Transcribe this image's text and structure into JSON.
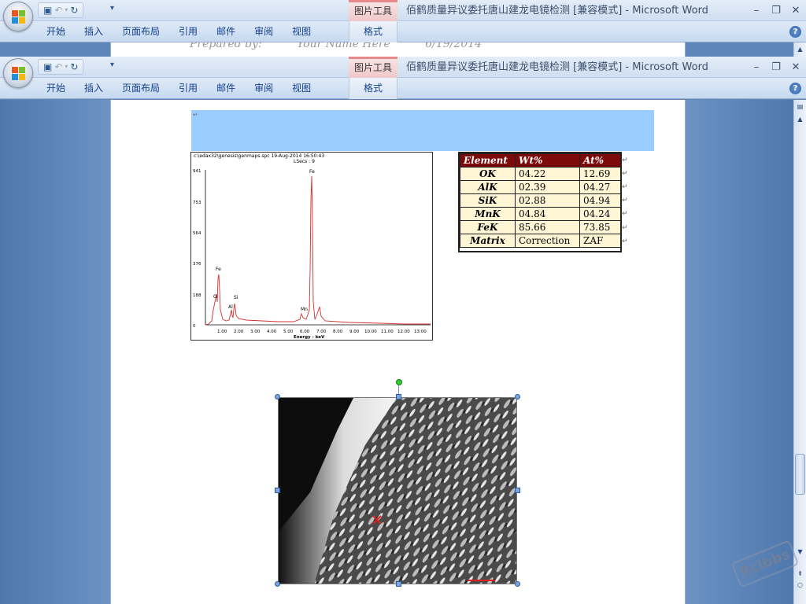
{
  "window": {
    "title": "佰鹤质量异议委托唐山建龙电镜检测 [兼容模式] - Microsoft Word",
    "context_tab_group": "图片工具",
    "context_tab": "格式",
    "controls": {
      "minimize": "–",
      "restore": "❐",
      "close": "✕"
    },
    "help": "?"
  },
  "ribbon_tabs": [
    "开始",
    "插入",
    "页面布局",
    "引用",
    "邮件",
    "审阅",
    "视图"
  ],
  "qat": {
    "save_icon": "save-icon",
    "undo_icon": "undo-icon",
    "redo_icon": "redo-icon"
  },
  "header_text": [
    "Prepared by:",
    "Your Name Here",
    "6/19/2014"
  ],
  "spectrum": {
    "path": "c:\\edax32\\genesis\\genmaps.spc  19-Aug-2014 16:50:43",
    "lsecs": "LSecs : 9",
    "xlabel": "Energy - keV",
    "y_ticks": [
      "941",
      "753",
      "564",
      "376",
      "188",
      "0"
    ],
    "x_ticks": [
      "1.00",
      "2.00",
      "3.00",
      "4.00",
      "5.00",
      "6.00",
      "7.00",
      "8.00",
      "9.00",
      "10.00",
      "11.00",
      "12.00",
      "13.00"
    ],
    "peak_labels": [
      "Fe",
      "O",
      "Al",
      "Si",
      "Mn",
      "Fe"
    ]
  },
  "table": {
    "headers": [
      "Element",
      "Wt%",
      "At%"
    ],
    "rows": [
      [
        "OK",
        "04.22",
        "12.69"
      ],
      [
        "AlK",
        "02.39",
        "04.27"
      ],
      [
        "SiK",
        "02.88",
        "04.94"
      ],
      [
        "MnK",
        "04.84",
        "04.24"
      ],
      [
        "FeK",
        "85.66",
        "73.85"
      ],
      [
        "Matrix",
        "Correction",
        "ZAF"
      ]
    ]
  },
  "watermark": "Rclbbs"
}
